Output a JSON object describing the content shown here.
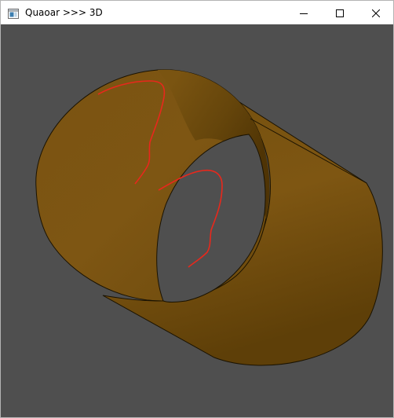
{
  "window": {
    "title": "Quaoar >>> 3D",
    "icon": "app-window-icon",
    "controls": [
      "minimize-icon",
      "maximize-icon",
      "close-icon"
    ]
  },
  "viewport": {
    "background": "#4f4f4f",
    "shape": "hollow-cylinder",
    "shape_color": "#7b5410",
    "edge_color": "#1a1200",
    "curve_color": "#e8281c",
    "curve_count": 2
  }
}
